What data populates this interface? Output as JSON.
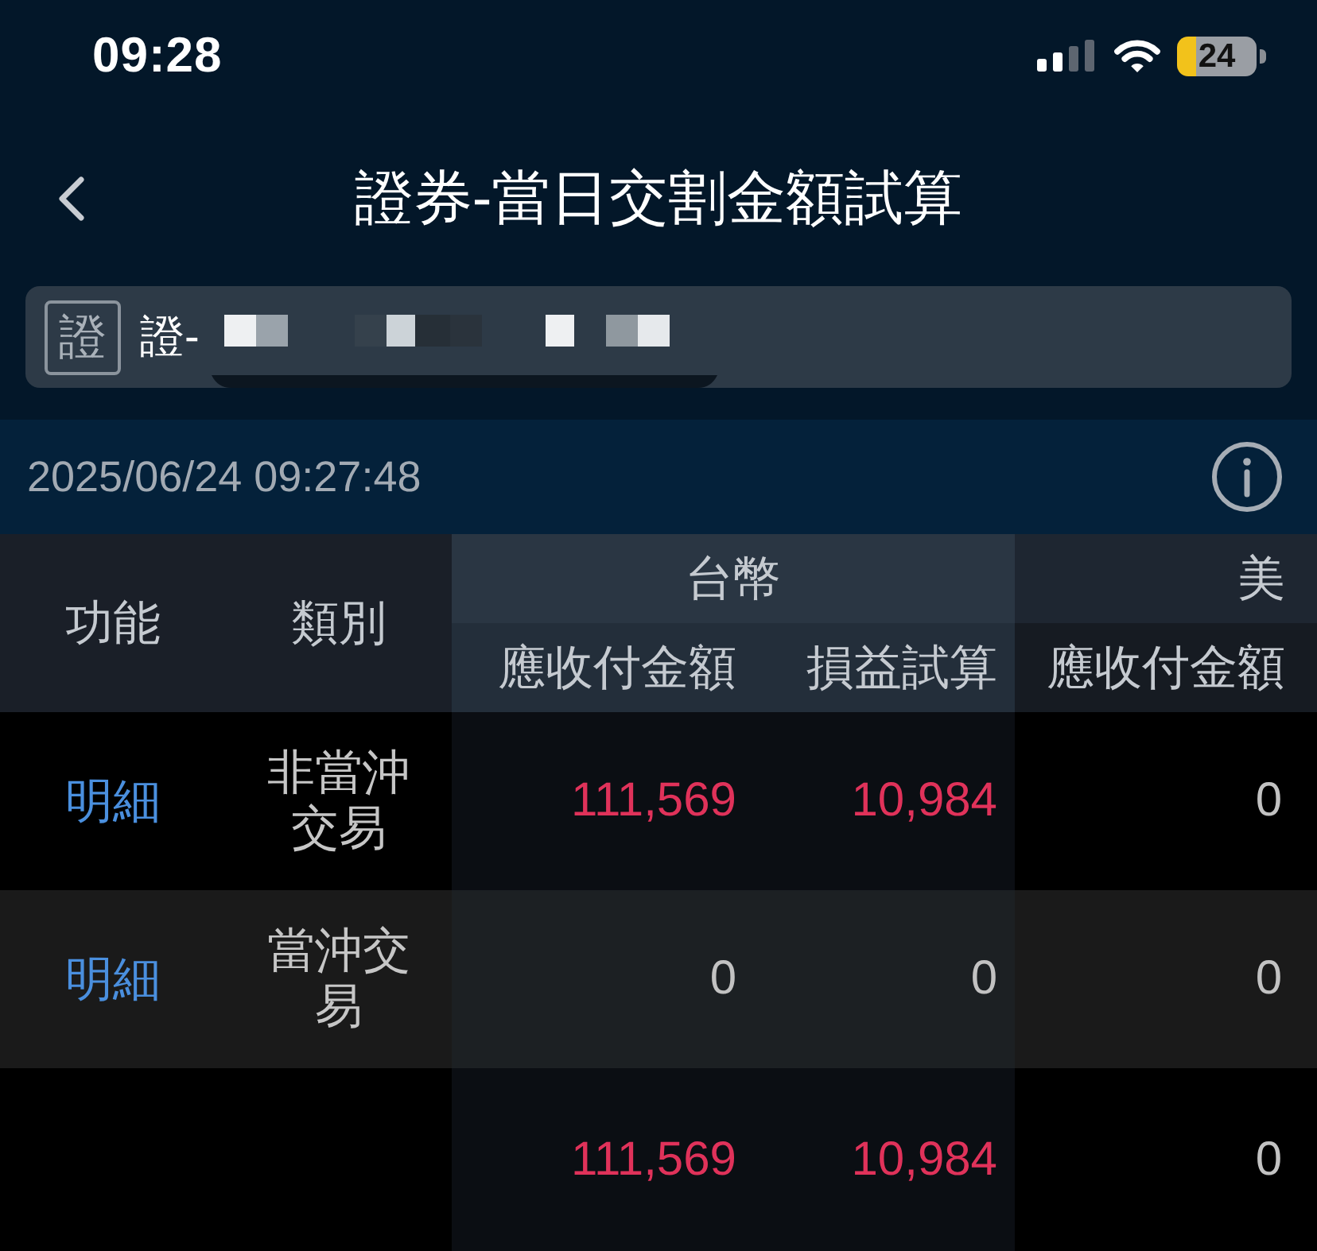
{
  "status_bar": {
    "time": "09:28",
    "battery": "24"
  },
  "header": {
    "title": "證券-當日交割金額試算"
  },
  "account": {
    "badge": "證",
    "value": "證-"
  },
  "info_bar": {
    "timestamp": "2025/06/24 09:27:48"
  },
  "table": {
    "columns": [
      {
        "label": "功能"
      },
      {
        "label": "類別"
      }
    ],
    "groups": [
      {
        "label": "台幣",
        "columns": [
          {
            "label": "應收付金額"
          },
          {
            "label": "損益試算"
          }
        ]
      },
      {
        "label": "美",
        "columns": [
          {
            "label": "應收付金額"
          }
        ]
      }
    ],
    "rows": [
      {
        "kind": "detail",
        "action": "明細",
        "category": "非當沖交易",
        "cells": [
          {
            "value": "111,569",
            "color": "#e0325a"
          },
          {
            "value": "10,984",
            "color": "#e0325a"
          },
          {
            "value": "0",
            "color": "#c2c2c2"
          }
        ]
      },
      {
        "kind": "detail",
        "action": "明細",
        "category": "當沖交易",
        "cells": [
          {
            "value": "0",
            "color": "#c2c2c2"
          },
          {
            "value": "0",
            "color": "#c2c2c2"
          },
          {
            "value": "0",
            "color": "#c2c2c2"
          }
        ]
      },
      {
        "kind": "total",
        "cells": [
          {
            "value": "111,569",
            "color": "#e0325a"
          },
          {
            "value": "10,984",
            "color": "#e0325a"
          },
          {
            "value": "0",
            "color": "#c2c2c2"
          }
        ]
      }
    ]
  }
}
